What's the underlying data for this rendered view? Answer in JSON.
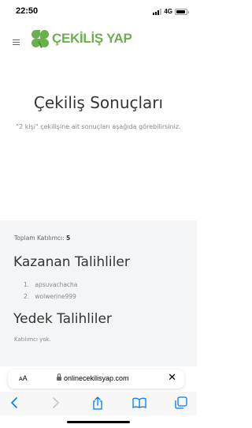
{
  "status_bar": {
    "time": "22:50",
    "network": "4G",
    "icons": [
      "signal-icon",
      "battery-icon"
    ],
    "battery_level": 0.9
  },
  "header": {
    "logo_text": "ÇEKİLİŞ YAP",
    "brand_color": "#6ab04c",
    "icons": [
      "menu-icon",
      "clover-icon"
    ]
  },
  "hero": {
    "title": "Çekiliş Sonuçları",
    "subtitle": "\"2 kişi\" çekilişine ait sonuçları aşağıda görebilirsiniz."
  },
  "results": {
    "participants_label": "Toplam Katılımcı:",
    "participants_count": "5",
    "winners_title": "Kazanan Talihliler",
    "winners": [
      {
        "num": "1.",
        "name": "apsuvachacha"
      },
      {
        "num": "2.",
        "name": "wolwerine999"
      }
    ],
    "backup_title": "Yedek Talihliler",
    "backup_empty_text": "Katılımcı yok."
  },
  "browser": {
    "aa_label_small": "A",
    "aa_label_large": "A",
    "url": "onlinecekilisyap.com",
    "close_symbol": "✕",
    "toolbar_icons": [
      "back-icon",
      "forward-icon",
      "share-icon",
      "bookmarks-icon",
      "tabs-icon"
    ],
    "accent_color": "#007aff"
  }
}
